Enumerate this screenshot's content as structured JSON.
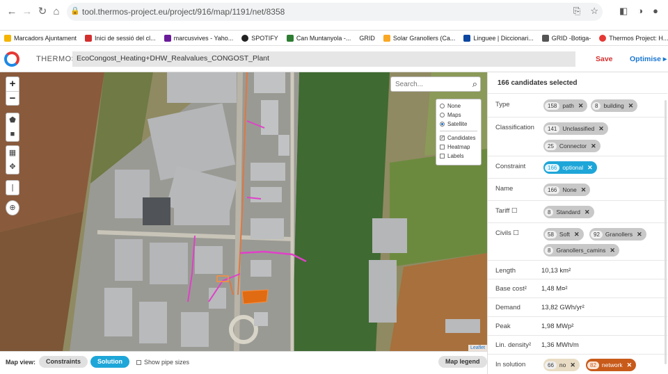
{
  "browser": {
    "url": "tool.thermos-project.eu/project/916/map/1191/net/8358",
    "bookmarks": [
      "Marcadors Ajuntament",
      "Inici de sessió del cl...",
      "marcusvives - Yaho...",
      "SPOTIFY",
      "Can Muntanyola -...",
      "GRID",
      "Solar Granollers (Ca...",
      "Linguee | Diccionari...",
      "GRID -Botiga-",
      "Thermos Project: H..."
    ]
  },
  "header": {
    "app_name": "THERMOS",
    "project_name": "EcoCongost_Heating+DHW_Realvalues_CONGOST_Plant",
    "save_label": "Save",
    "optimise_label": "Optimise ▸"
  },
  "map": {
    "search_placeholder": "Search...",
    "layers": {
      "base": [
        {
          "label": "None",
          "selected": false
        },
        {
          "label": "Maps",
          "selected": false
        },
        {
          "label": "Satellite",
          "selected": true
        }
      ],
      "overlays": [
        {
          "label": "Candidates",
          "checked": true
        },
        {
          "label": "Heatmap",
          "checked": false
        },
        {
          "label": "Labels",
          "checked": false
        }
      ]
    },
    "attribution": "Leaflet"
  },
  "bottom": {
    "map_view_label": "Map view:",
    "constraints_label": "Constraints",
    "solution_label": "Solution",
    "pipe_sizes_label": "Show pipe sizes",
    "map_legend_label": "Map legend"
  },
  "panel": {
    "title": "166 candidates selected",
    "type": {
      "label": "Type",
      "chips": [
        {
          "n": "158",
          "t": "path"
        },
        {
          "n": "8",
          "t": "building"
        }
      ]
    },
    "classification": {
      "label": "Classification",
      "chips": [
        {
          "n": "141",
          "t": "Unclassified"
        },
        {
          "n": "25",
          "t": "Connector"
        }
      ]
    },
    "constraint": {
      "label": "Constraint",
      "chips": [
        {
          "n": "166",
          "t": "optional"
        }
      ]
    },
    "name": {
      "label": "Name",
      "chips": [
        {
          "n": "166",
          "t": "None"
        }
      ]
    },
    "tariff": {
      "label": "Tariff ☐",
      "chips": [
        {
          "n": "8",
          "t": "Standard"
        }
      ]
    },
    "civils": {
      "label": "Civils ☐",
      "chips": [
        {
          "n": "58",
          "t": "Soft"
        },
        {
          "n": "92",
          "t": "Granollers"
        },
        {
          "n": "8",
          "t": "Granollers_camins"
        }
      ]
    },
    "length": {
      "label": "Length",
      "value": "10,13 km²"
    },
    "base_cost": {
      "label": "Base cost²",
      "value": "1,48 M¤²"
    },
    "demand": {
      "label": "Demand",
      "value": "13,82 GWh/yr²"
    },
    "peak": {
      "label": "Peak",
      "value": "1,98 MWp²"
    },
    "lin_density": {
      "label": "Lin. density²",
      "value": "1,36 MWh/m"
    },
    "in_solution": {
      "label": "In solution",
      "chips": [
        {
          "n": "66",
          "t": "no"
        },
        {
          "n": "82",
          "t": "network"
        }
      ]
    }
  },
  "colors": {
    "accent_blue": "#1ea6d8",
    "save_red": "#d32f2f",
    "network_orange": "#c85a1a",
    "path_magenta": "#e040c8"
  }
}
